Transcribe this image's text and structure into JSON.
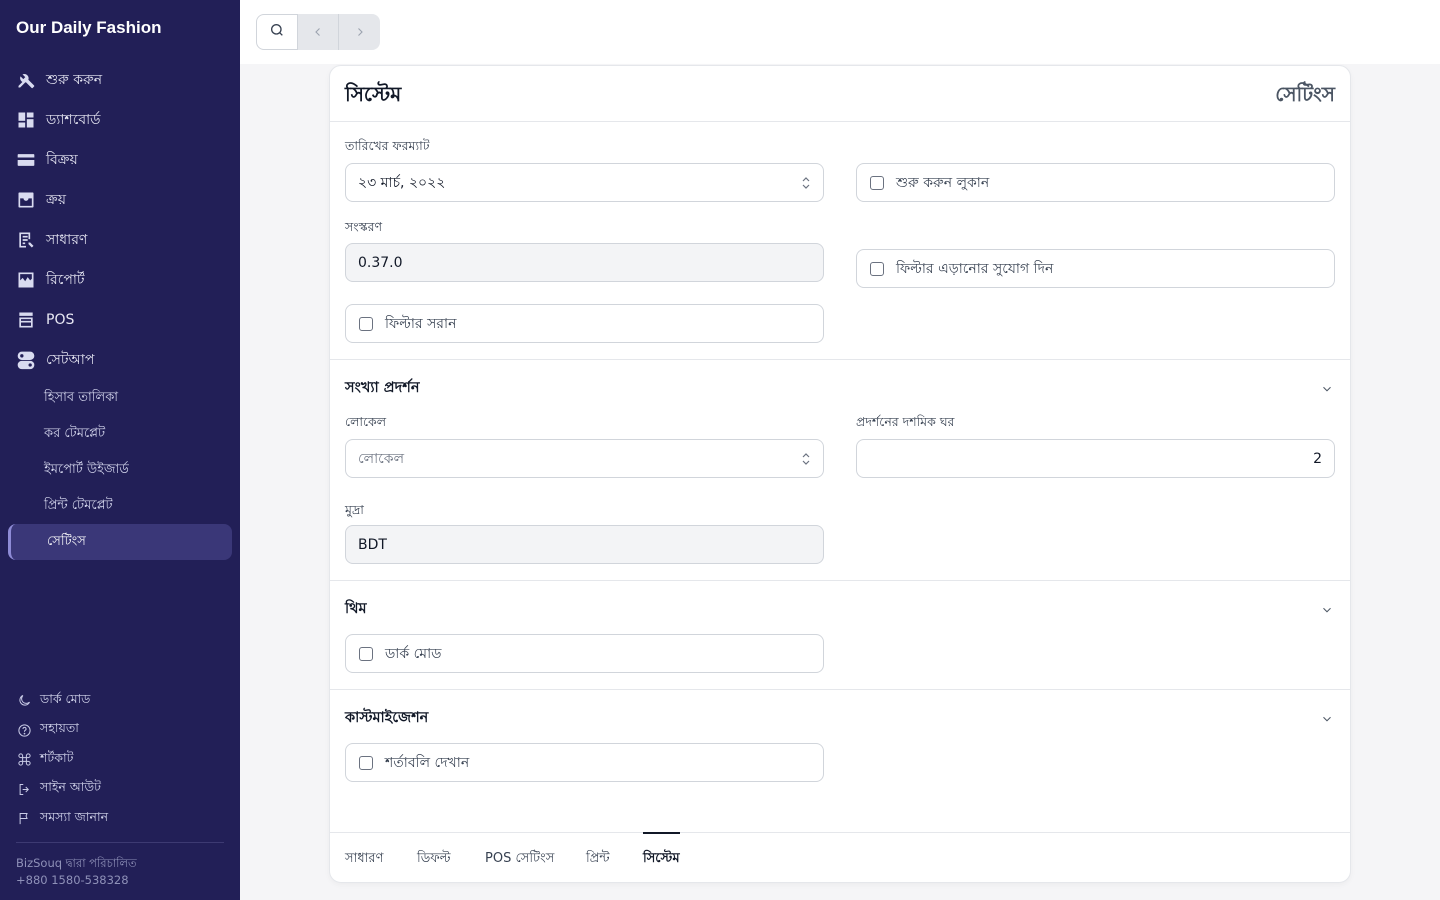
{
  "app": {
    "name": "Our Daily Fashion"
  },
  "sidebar": {
    "items": [
      {
        "label": "শুরু করুন",
        "icon": "tools-icon"
      },
      {
        "label": "ড্যাশবোর্ড",
        "icon": "dashboard-icon"
      },
      {
        "label": "বিক্রয়",
        "icon": "sales-card-icon"
      },
      {
        "label": "ক্রয়",
        "icon": "purchase-tray-icon"
      },
      {
        "label": "সাধারণ",
        "icon": "journal-icon"
      },
      {
        "label": "রিপোর্ট",
        "icon": "report-chart-icon"
      },
      {
        "label": "POS",
        "icon": "pos-register-icon"
      },
      {
        "label": "সেটআপ",
        "icon": "setup-toggle-icon"
      }
    ],
    "setup_children": [
      {
        "label": "হিসাব তালিকা"
      },
      {
        "label": "কর টেমপ্লেট"
      },
      {
        "label": "ইমপোর্ট উইজার্ড"
      },
      {
        "label": "প্রিন্ট টেমপ্লেট"
      },
      {
        "label": "সেটিংস",
        "active": true
      }
    ],
    "bottom": [
      {
        "label": "ডার্ক মোড",
        "icon": "moon-icon"
      },
      {
        "label": "সহায়তা",
        "icon": "help-circle-icon"
      },
      {
        "label": "শর্টকাট",
        "icon": "command-key-icon"
      },
      {
        "label": "সাইন আউট",
        "icon": "sign-out-icon"
      },
      {
        "label": "সমস্যা জানান",
        "icon": "flag-icon"
      }
    ],
    "footer": {
      "powered_by": "BizSouq দ্বারা পরিচালিত",
      "phone": "+880 1580-538328"
    }
  },
  "page": {
    "title": "সিস্টেম",
    "title_right": "সেটিংস",
    "system": {
      "date_format_label": "তারিখের ফরম্যাট",
      "date_format_value": "২৩ মার্চ, ২০২২",
      "version_label": "সংস্করণ",
      "version_value": "0.37.0",
      "hide_get_started": "শুরু করুন লুকান",
      "allow_filter_bypass": "ফিল্টার এড়ানোর সুযোগ দিন",
      "remove_filter": "ফিল্টার সরান"
    },
    "number_display": {
      "title": "সংখ্যা প্রদর্শন",
      "locale_label": "লোকেল",
      "locale_placeholder": "লোকেল",
      "decimal_label": "প্রদর্শনের দশমিক ঘর",
      "decimal_value": "2",
      "currency_label": "মুদ্রা",
      "currency_value": "BDT"
    },
    "theme": {
      "title": "থিম",
      "dark_mode": "ডার্ক মোড"
    },
    "customization": {
      "title": "কাস্টমাইজেশন",
      "show_terms": "শর্তাবলি দেখান"
    },
    "tabs": [
      {
        "label": "সাধারণ"
      },
      {
        "label": "ডিফল্ট"
      },
      {
        "label": "POS সেটিংস"
      },
      {
        "label": "প্রিন্ট"
      },
      {
        "label": "সিস্টেম",
        "active": true
      }
    ]
  }
}
